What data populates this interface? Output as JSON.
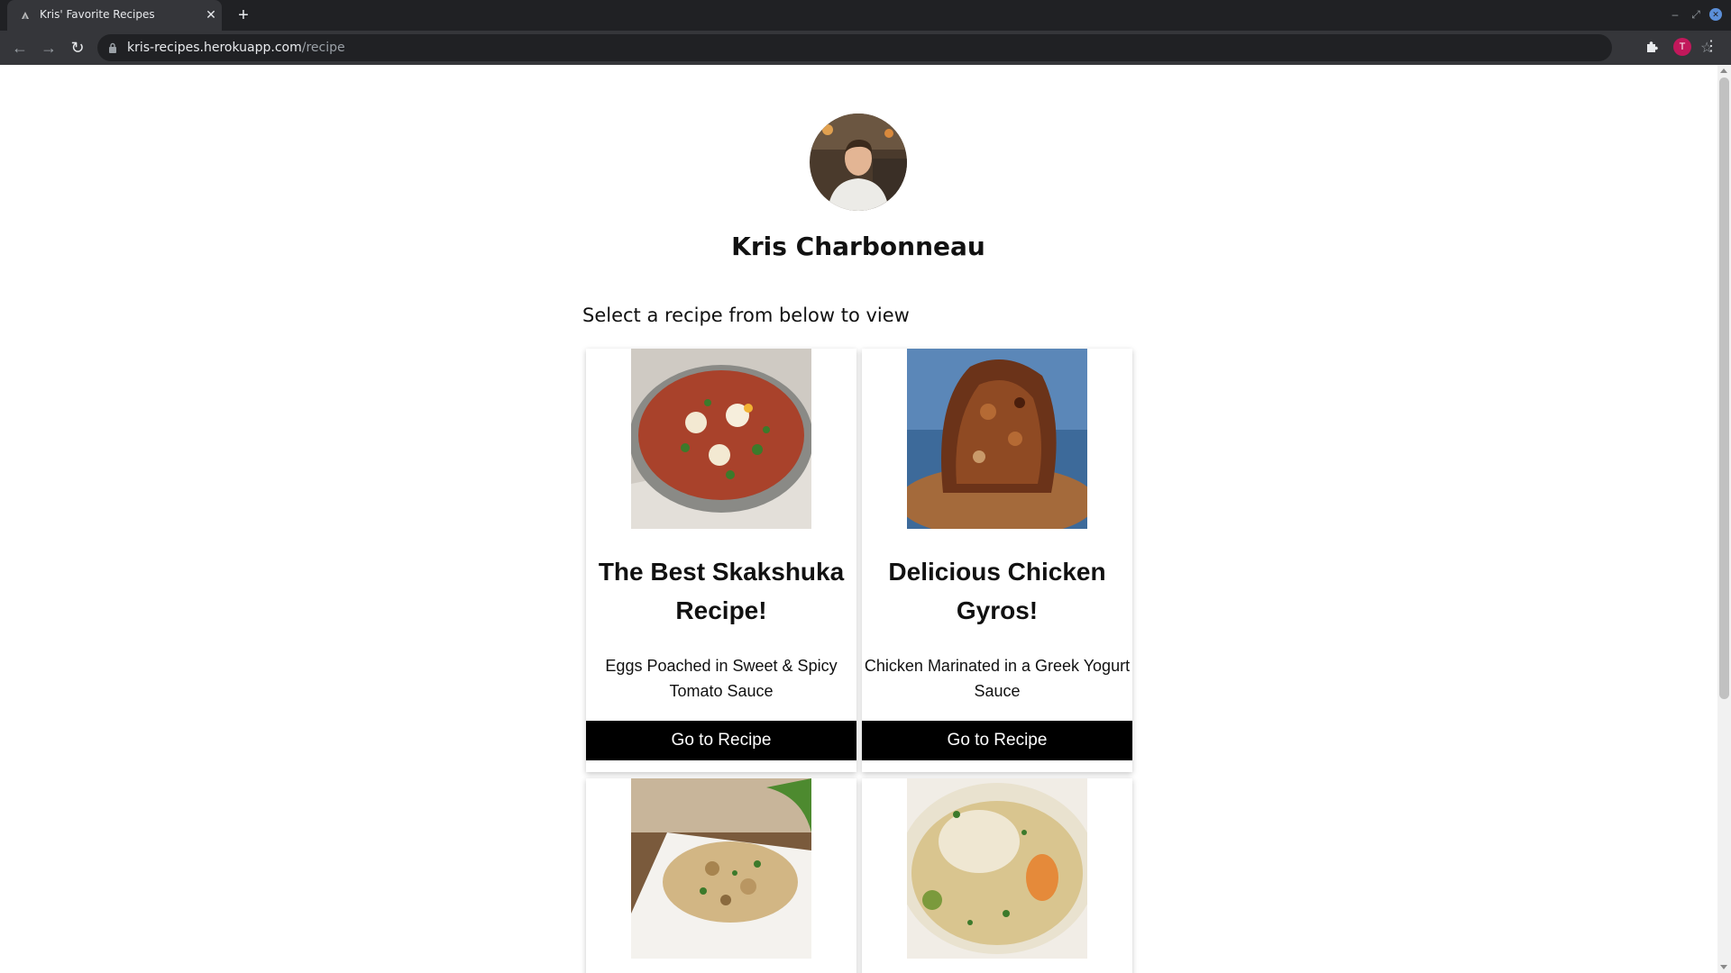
{
  "browser": {
    "tab_title": "Kris' Favorite Recipes",
    "url_host": "kris-recipes.herokuapp.com",
    "url_path": "/recipe",
    "profile_initial": "T"
  },
  "profile": {
    "name": "Kris Charbonneau"
  },
  "prompt": "Select a recipe from below to view",
  "recipes": [
    {
      "title": "The Best Skakshuka Recipe!",
      "description": "Eggs Poached in Sweet & Spicy Tomato Sauce",
      "button": "Go to Recipe"
    },
    {
      "title": "Delicious Chicken Gyros!",
      "description": "Chicken Marinated in a Greek Yogurt Sauce",
      "button": "Go to Recipe"
    },
    {
      "title": "",
      "description": "",
      "button": ""
    },
    {
      "title": "",
      "description": "",
      "button": ""
    }
  ],
  "colors": {
    "button_bg": "#000000",
    "chrome_dark": "#202124",
    "chrome_toolbar": "#35363a",
    "profile_badge": "#c2185b"
  }
}
